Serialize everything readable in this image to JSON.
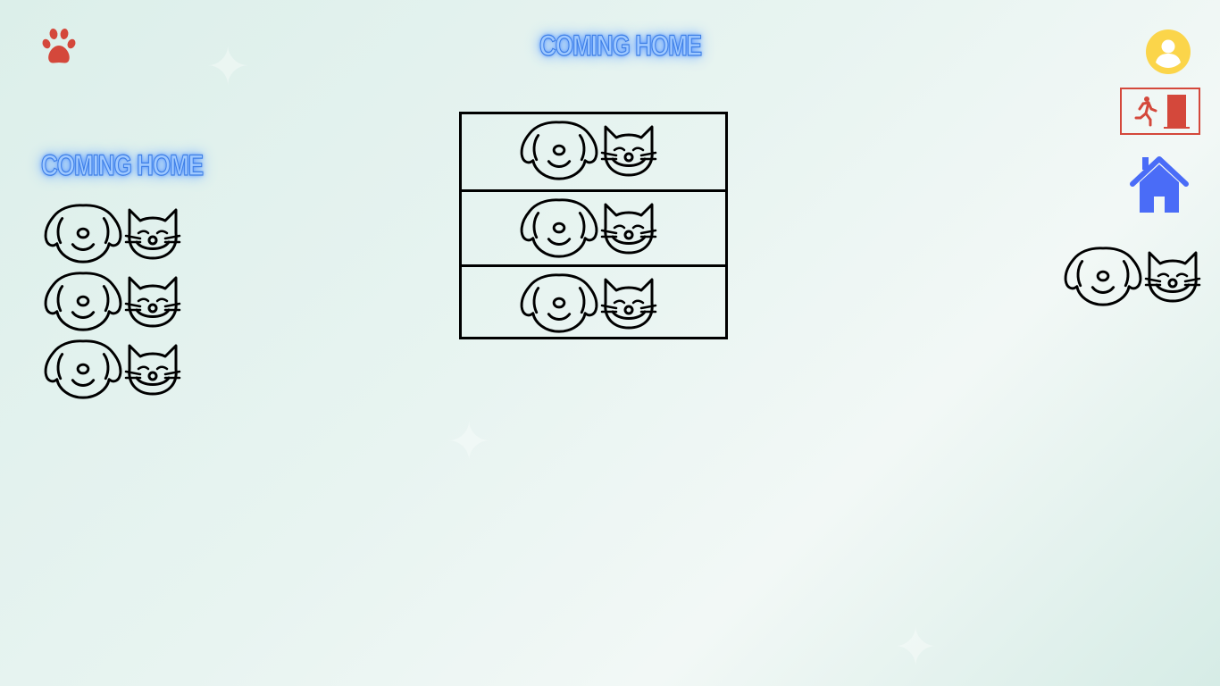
{
  "header": {
    "title": "COMING HOME"
  },
  "sidebar": {
    "title": "COMING HOME"
  },
  "icons": {
    "logo": "paw-icon",
    "profile": "user-circle-icon",
    "logout": "exit-door-icon",
    "home": "home-icon",
    "pet_pair": "dog-cat-icon"
  },
  "colors": {
    "paw": "#d4483b",
    "avatar": "#fbd54a",
    "exit": "#d4483b",
    "home": "#4a6cf7",
    "neon_text": "#3e7fe6"
  },
  "sidebar_items": [
    {
      "icon": "dog-cat-icon"
    },
    {
      "icon": "dog-cat-icon"
    },
    {
      "icon": "dog-cat-icon"
    }
  ],
  "grid_cells": [
    {
      "icon": "dog-cat-icon"
    },
    {
      "icon": "dog-cat-icon"
    },
    {
      "icon": "dog-cat-icon"
    }
  ]
}
